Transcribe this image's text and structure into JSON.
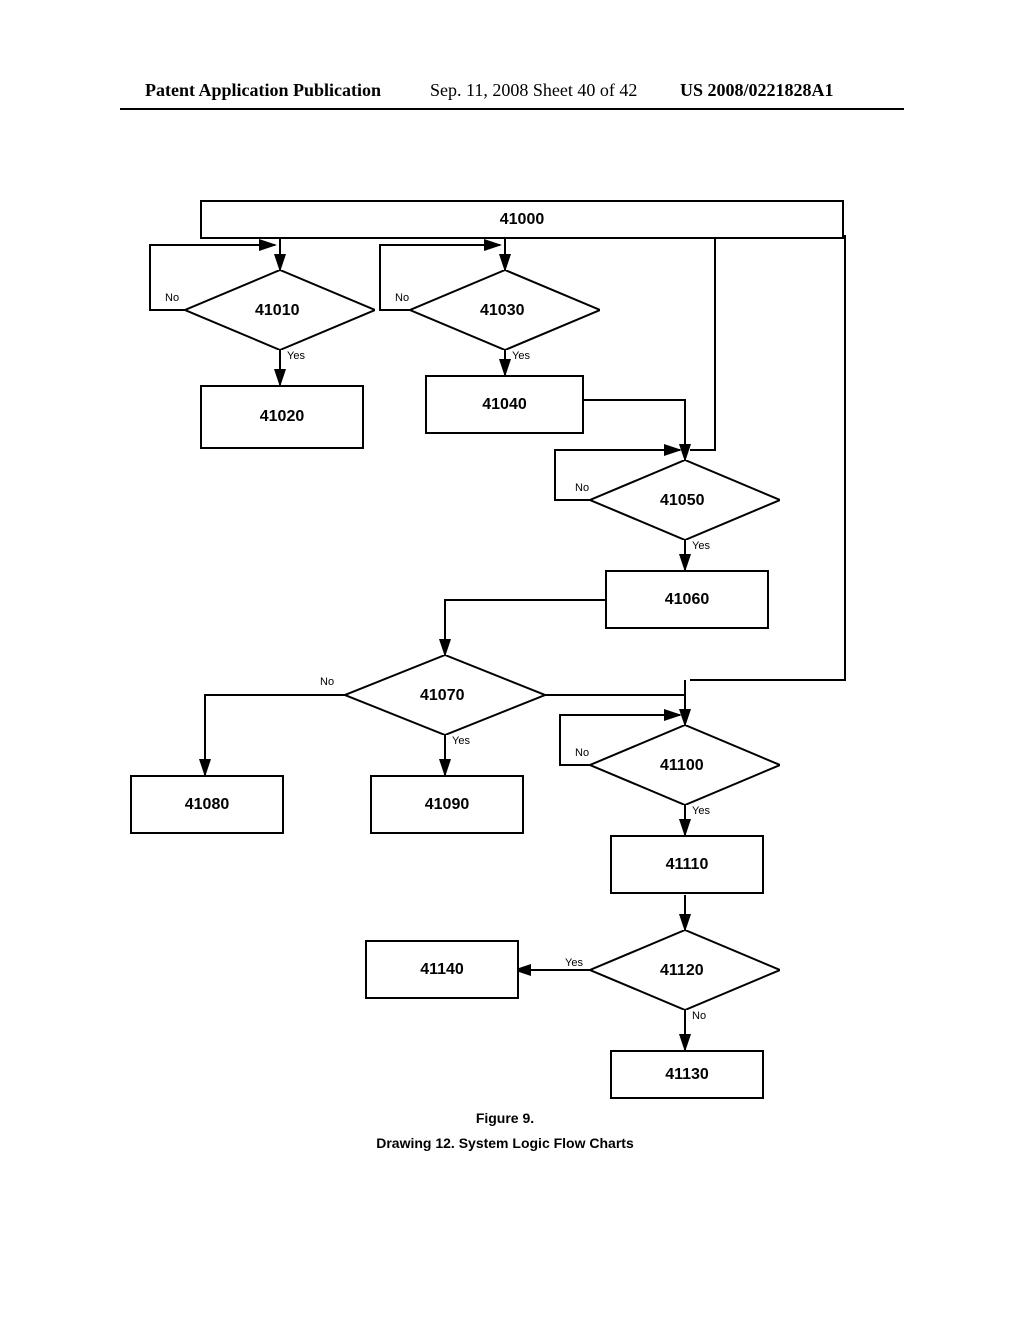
{
  "header": {
    "left": "Patent Application Publication",
    "center": "Sep. 11, 2008  Sheet 40 of 42",
    "right": "US 2008/0221828A1"
  },
  "nodes": {
    "n41000": "41000",
    "n41010": "41010",
    "n41020": "41020",
    "n41030": "41030",
    "n41040": "41040",
    "n41050": "41050",
    "n41060": "41060",
    "n41070": "41070",
    "n41080": "41080",
    "n41090": "41090",
    "n41100": "41100",
    "n41110": "41110",
    "n41120": "41120",
    "n41130": "41130",
    "n41140": "41140"
  },
  "labels": {
    "yes": "Yes",
    "no": "No"
  },
  "caption": {
    "fig": "Figure 9.",
    "title": "Drawing 12. System Logic Flow Charts"
  },
  "chart_data": {
    "type": "flowchart",
    "title": "Drawing 12. System Logic Flow Charts — Figure 9",
    "nodes": [
      {
        "id": "41000",
        "shape": "process-wide"
      },
      {
        "id": "41010",
        "shape": "decision"
      },
      {
        "id": "41020",
        "shape": "process"
      },
      {
        "id": "41030",
        "shape": "decision"
      },
      {
        "id": "41040",
        "shape": "process"
      },
      {
        "id": "41050",
        "shape": "decision"
      },
      {
        "id": "41060",
        "shape": "process"
      },
      {
        "id": "41070",
        "shape": "decision"
      },
      {
        "id": "41080",
        "shape": "process"
      },
      {
        "id": "41090",
        "shape": "process"
      },
      {
        "id": "41100",
        "shape": "decision"
      },
      {
        "id": "41110",
        "shape": "process"
      },
      {
        "id": "41120",
        "shape": "decision"
      },
      {
        "id": "41130",
        "shape": "process"
      },
      {
        "id": "41140",
        "shape": "process"
      }
    ],
    "edges": [
      {
        "from": "41000",
        "to": "41010"
      },
      {
        "from": "41000",
        "to": "41030"
      },
      {
        "from": "41000",
        "to": "41050",
        "note": "via bus line down right"
      },
      {
        "from": "41000",
        "to": "41100",
        "note": "via bus line far right"
      },
      {
        "from": "41010",
        "to": "41020",
        "label": "Yes"
      },
      {
        "from": "41010",
        "to": "41000",
        "label": "No",
        "note": "loop back up"
      },
      {
        "from": "41030",
        "to": "41040",
        "label": "Yes"
      },
      {
        "from": "41030",
        "to": "41000",
        "label": "No",
        "note": "loop back up"
      },
      {
        "from": "41040",
        "to": "41050"
      },
      {
        "from": "41050",
        "to": "41060",
        "label": "Yes"
      },
      {
        "from": "41050",
        "to": "41050",
        "label": "No",
        "note": "self-loop back to top"
      },
      {
        "from": "41060",
        "to": "41070"
      },
      {
        "from": "41070",
        "to": "41090",
        "label": "Yes"
      },
      {
        "from": "41070",
        "to": "41080",
        "label": "No"
      },
      {
        "from": "41070",
        "to": "41100",
        "note": "right exit merges"
      },
      {
        "from": "41100",
        "to": "41110",
        "label": "Yes"
      },
      {
        "from": "41100",
        "to": "41100",
        "label": "No",
        "note": "self-loop"
      },
      {
        "from": "41110",
        "to": "41120"
      },
      {
        "from": "41120",
        "to": "41140",
        "label": "Yes"
      },
      {
        "from": "41120",
        "to": "41130",
        "label": "No"
      }
    ]
  }
}
